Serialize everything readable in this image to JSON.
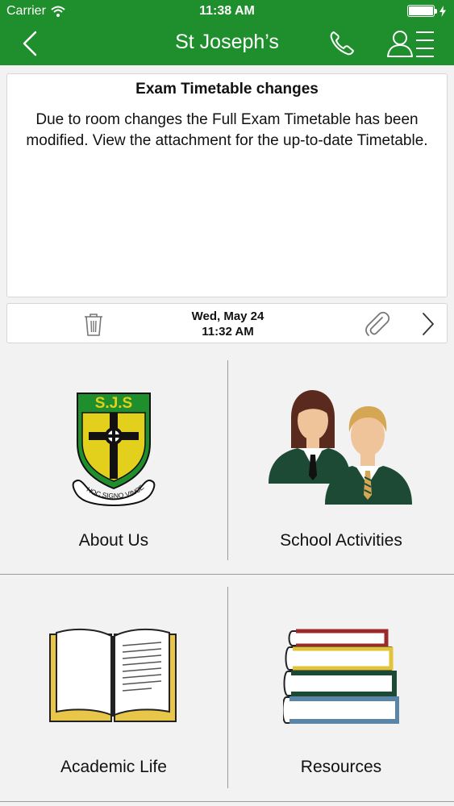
{
  "status_bar": {
    "carrier": "Carrier",
    "time": "11:38 AM"
  },
  "nav": {
    "title": "St Joseph’s",
    "back_icon": "chevron-left-icon",
    "phone_icon": "phone-icon",
    "contacts_icon": "contacts-list-icon"
  },
  "message": {
    "title": "Exam Timetable changes",
    "body": "Due to room changes the Full Exam Timetable  has been modified.  View the attachment for the up-to-date Timetable."
  },
  "action_bar": {
    "date": "Wed, May 24",
    "time": "11:32 AM"
  },
  "school_crest": {
    "initials": "S.J.S",
    "motto": "IN HOC SIGNO VINCES"
  },
  "tiles": [
    {
      "label": "About Us",
      "icon": "school-crest-icon"
    },
    {
      "label": "School Activities",
      "icon": "students-icon"
    },
    {
      "label": "Academic Life",
      "icon": "open-book-icon"
    },
    {
      "label": "Resources",
      "icon": "book-stack-icon"
    }
  ],
  "colors": {
    "brand_green": "#1e8f2c",
    "crest_yellow": "#e2d01c",
    "uniform_green": "#1d4a34"
  }
}
